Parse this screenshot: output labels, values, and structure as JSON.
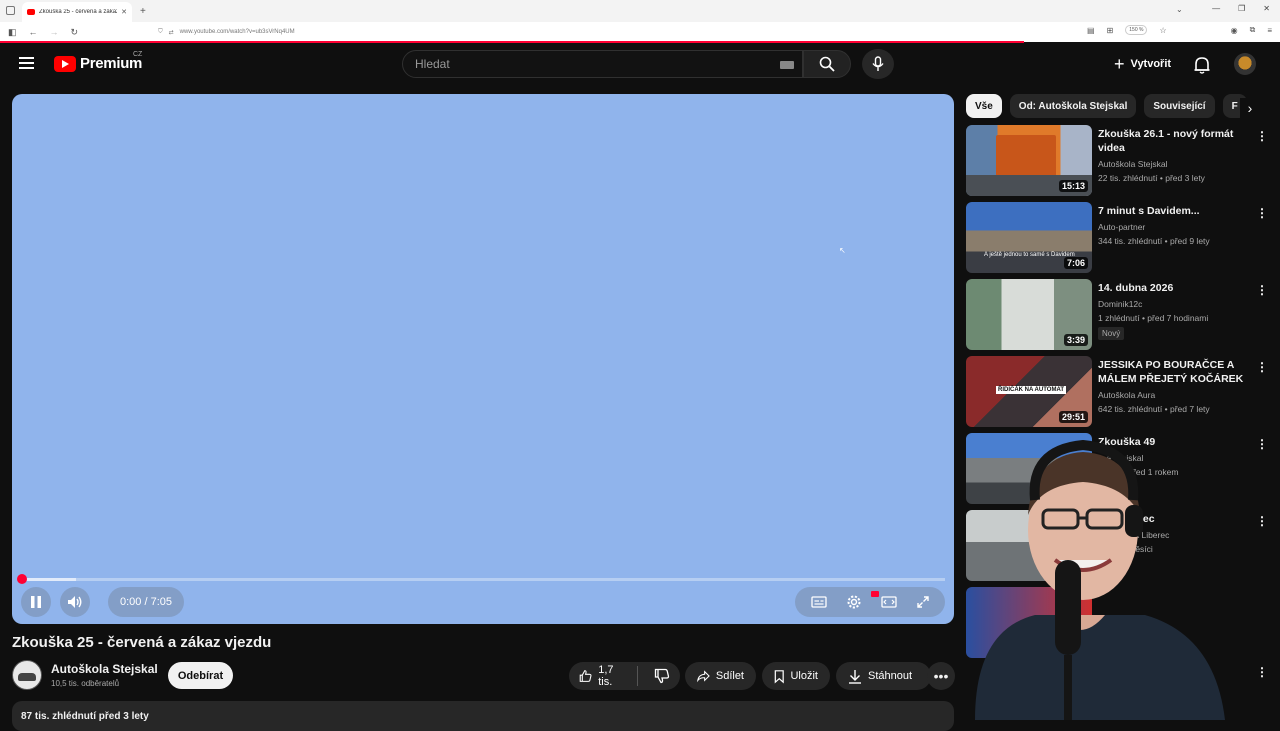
{
  "browser": {
    "tab_title": "Zkouška 25 - červená a zákaz v…",
    "url": "www.youtube.com/watch?v=ub3sVrNq4UM",
    "zoom": "150 %"
  },
  "header": {
    "logo_text": "Premium",
    "country": "CZ",
    "search_placeholder": "Hledat",
    "create_label": "Vytvořit"
  },
  "player": {
    "time": "0:00 / 7:05",
    "progress_fraction": 0.0,
    "buffered_fraction": 0.06,
    "hd_badge": "HD"
  },
  "video": {
    "title": "Zkouška 25 - červená a zákaz vjezdu",
    "channel": "Autoškola Stejskal",
    "subscribers": "10,5 tis. odběratelů",
    "subscribe_label": "Odebírat",
    "likes": "1,7 tis.",
    "share_label": "Sdílet",
    "save_label": "Uložit",
    "download_label": "Stáhnout",
    "description_stats": "87 tis. zhlédnutí  před 3 lety"
  },
  "chips": [
    "Vše",
    "Od: Autoškola Stejskal",
    "Související",
    "F"
  ],
  "recommendations": [
    {
      "title": "Zkouška 26.1 - nový formát videa",
      "channel": "Autoškola Stejskal",
      "meta": "22 tis. zhlédnutí • před 3 lety",
      "duration": "15:13",
      "badge": ""
    },
    {
      "title": "7 minut s Davidem...",
      "channel": "Auto-partner",
      "meta": "344 tis. zhlédnutí • před 9 lety",
      "duration": "7:06",
      "badge": ""
    },
    {
      "title": "14. dubna 2026",
      "channel": "Dominik12c",
      "meta": "1 zhlédnutí • před 7 hodinami",
      "duration": "3:39",
      "badge": "Nový"
    },
    {
      "title": "JESSIKA PO BOURAČCE A MÁLEM PŘEJETÝ KOČÁREK | ...",
      "channel": "Autoškola Aura",
      "meta": "642 tis. zhlédnutí • před 7 lety",
      "duration": "29:51",
      "badge": ""
    },
    {
      "title": "Zkouška 49",
      "channel": "…a Stejskal",
      "meta": "…nutí • před 1 rokem",
      "duration": "",
      "badge": ""
    },
    {
      "title": "…ă Liberec",
      "channel": "…artošová Liberec",
      "meta": "…řed 2 měsíci",
      "duration": "",
      "badge": ""
    }
  ],
  "thumb_texts": {
    "rec2_caption": "A ještě jednou to samé s Davidem",
    "rec4_caption": "ŘIDIČÁK NA AUTOMAT"
  }
}
